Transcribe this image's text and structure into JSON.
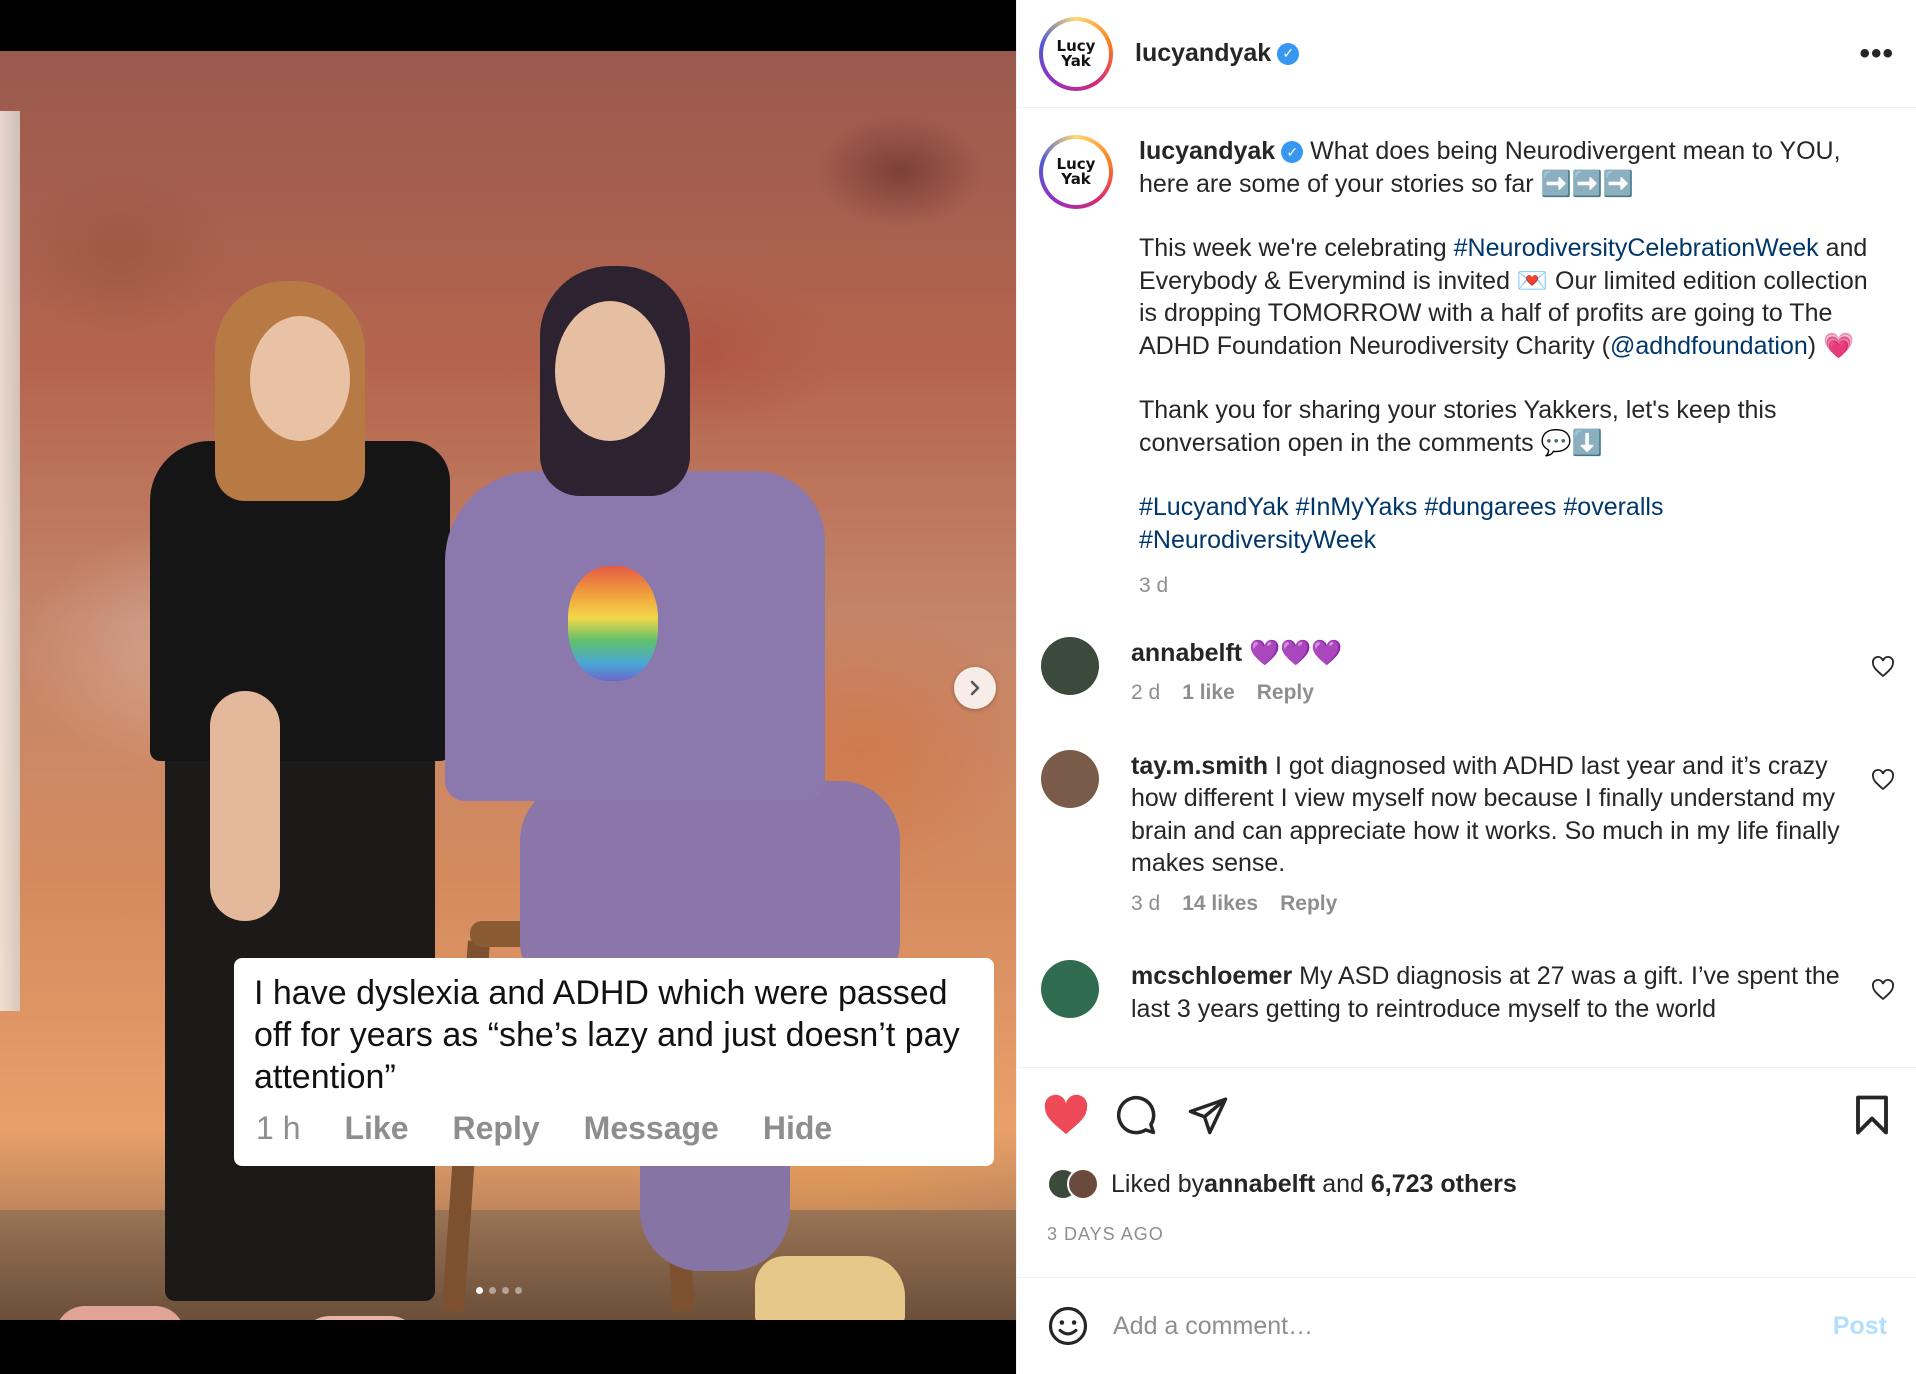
{
  "post": {
    "username": "lucyandyak",
    "avatar_text": [
      "Lucy",
      "Yak"
    ],
    "quote": {
      "text": "I have dyslexia and ADHD which were passed off for years as “she’s lazy and just doesn’t pay attention”",
      "time": "1 h",
      "like": "Like",
      "reply": "Reply",
      "message": "Message",
      "hide": "Hide"
    },
    "carousel": {
      "slides": 4,
      "active": 1
    }
  },
  "caption": {
    "username": "lucyandyak",
    "line1": " What does being Neurodivergent mean to YOU, here are some of your stories so far ➡️➡️➡️",
    "p2_a": "This week we're celebrating ",
    "p2_tag": "#NeurodiversityCelebrationWeek",
    "p2_b": " and Everybody & Everymind is invited 💌 Our limited edition collection is dropping TOMORROW with a half of profits are going to The ADHD Foundation Neurodiversity Charity (",
    "p2_mention": "@adhdfoundation",
    "p2_c": ") 💗",
    "p3": "Thank you for sharing your stories Yakkers, let's keep this conversation open in the comments 💬⬇️",
    "tags": [
      "#LucyandYak",
      "#InMyYaks",
      "#dungarees",
      "#overalls",
      "#NeurodiversityWeek"
    ],
    "time": "3 d"
  },
  "comments": [
    {
      "user": "annabelft",
      "text": " 💜💜💜",
      "time": "2 d",
      "likes": "1 like",
      "reply": "Reply",
      "avatar_color": "#3b4a3a"
    },
    {
      "user": "tay.m.smith",
      "text": " I got diagnosed with ADHD last year and it’s crazy how different I view myself now because I finally understand my brain and can appreciate how it works. So much in my life finally makes sense.",
      "time": "3 d",
      "likes": "14 likes",
      "reply": "Reply",
      "avatar_color": "#7a5a48"
    },
    {
      "user": "mcschloemer",
      "text": " My ASD diagnosis at 27 was a gift. I’ve spent the last 3 years getting to reintroduce myself to the world",
      "avatar_color": "#2f6b4f"
    }
  ],
  "likes": {
    "prefix": "Liked by ",
    "user": "annabelft",
    "mid": " and ",
    "others": "6,723 others"
  },
  "date": "3 DAYS AGO",
  "composer": {
    "placeholder": "Add a comment…",
    "post_label": "Post"
  },
  "colors": {
    "like_red": "#ed4956",
    "link": "#00376b",
    "meta_gray": "#8e8e8e",
    "post_blue": "#b2dffc",
    "verified": "#3897f0"
  }
}
